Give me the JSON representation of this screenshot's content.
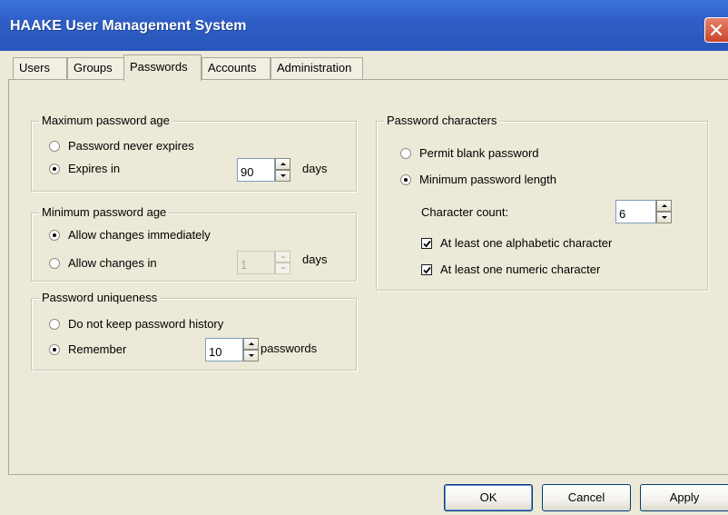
{
  "window": {
    "title": "HAAKE User Management System"
  },
  "tabs": [
    {
      "label": "Users"
    },
    {
      "label": "Groups"
    },
    {
      "label": "Passwords"
    },
    {
      "label": "Accounts"
    },
    {
      "label": "Administration"
    }
  ],
  "active_tab": "Passwords",
  "max_age": {
    "title": "Maximum password age",
    "never_expires_label": "Password never expires",
    "expires_in_label": "Expires in",
    "selected": "Expires in",
    "days_value": "90",
    "days_unit": "days"
  },
  "min_age": {
    "title": "Minimum password age",
    "immediately_label": "Allow changes immediately",
    "allow_in_label": "Allow changes in",
    "selected": "Allow changes immediately",
    "days_value": "1",
    "days_unit": "days"
  },
  "uniqueness": {
    "title": "Password uniqueness",
    "no_history_label": "Do not keep password history",
    "remember_label": "Remember",
    "selected": "Remember",
    "count_value": "10",
    "count_unit": "passwords"
  },
  "characters": {
    "title": "Password characters",
    "permit_blank_label": "Permit blank password",
    "min_length_label": "Minimum password length",
    "selected": "Minimum password length",
    "count_label": "Character count:",
    "count_value": "6",
    "alpha_label": "At least one alphabetic character",
    "alpha_checked": true,
    "numeric_label": "At least one numeric character",
    "numeric_checked": true
  },
  "buttons": {
    "ok": "OK",
    "cancel": "Cancel",
    "apply": "Apply"
  },
  "icons": {
    "close": "close-icon"
  },
  "colors": {
    "titlebar": "#2f5fc6",
    "close": "#d9573a",
    "dialog": "#ece9d8"
  }
}
